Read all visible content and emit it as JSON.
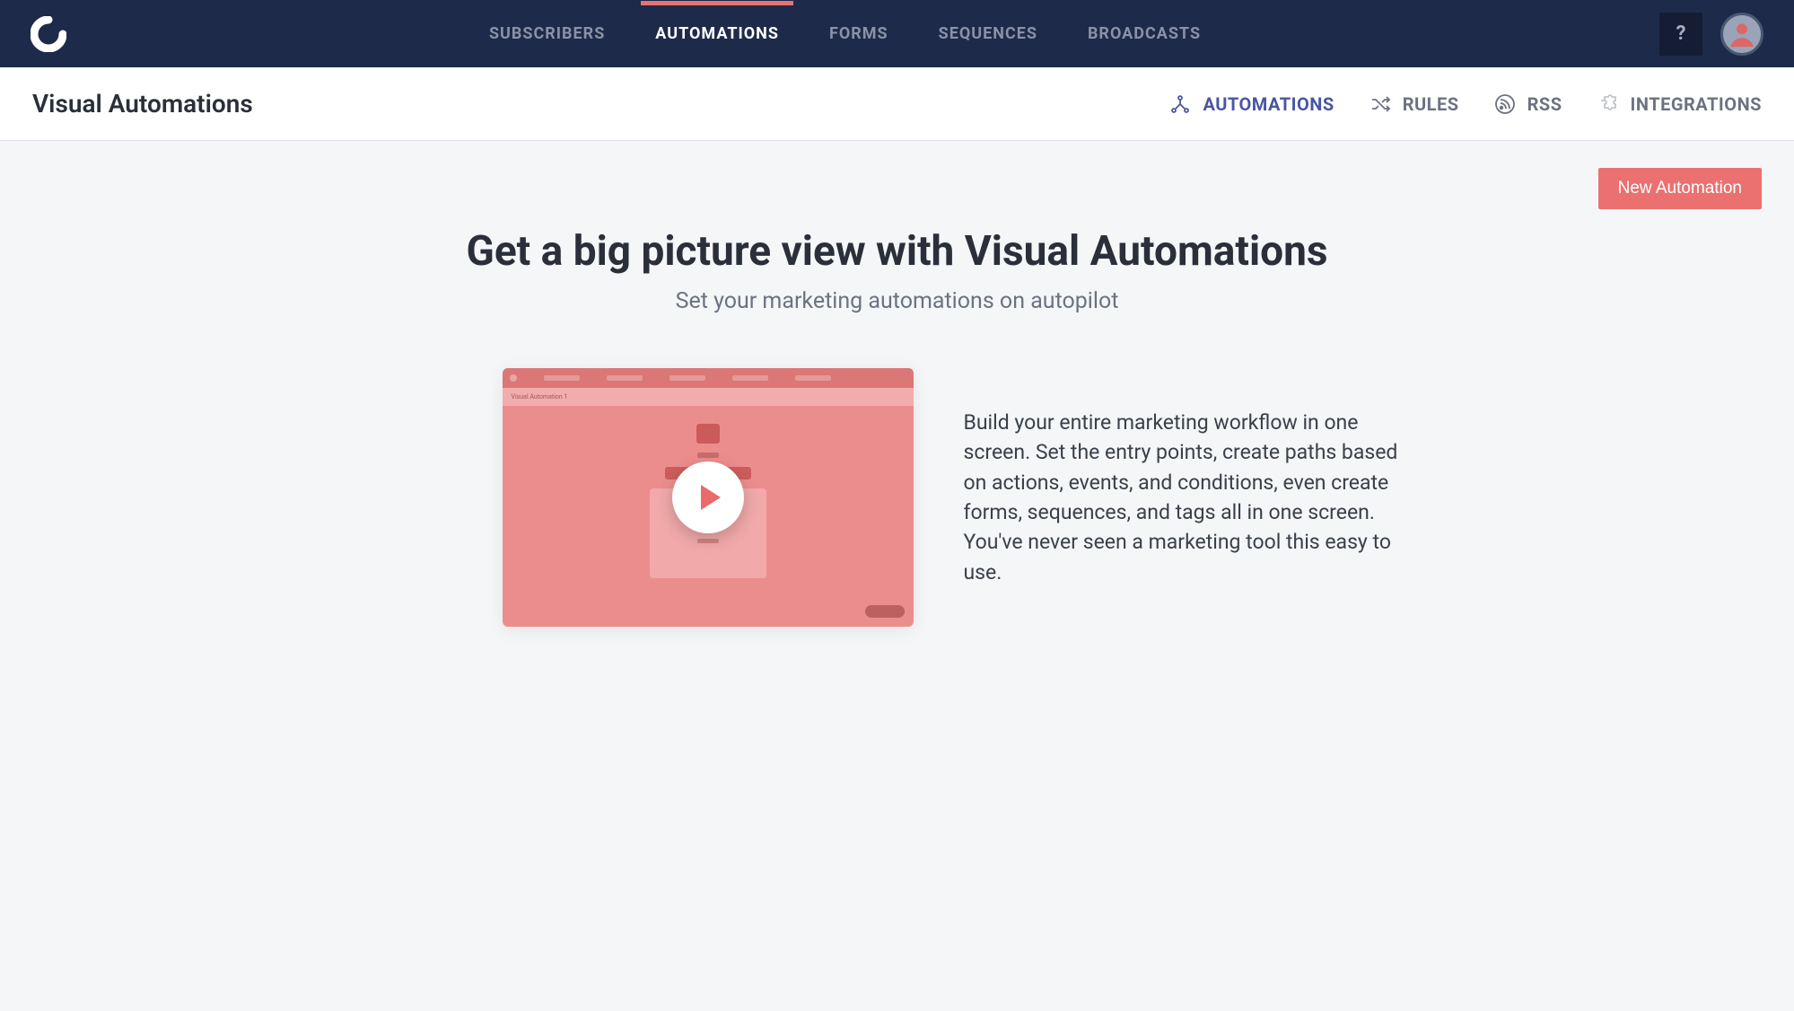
{
  "nav": {
    "items": [
      {
        "label": "SUBSCRIBERS"
      },
      {
        "label": "AUTOMATIONS"
      },
      {
        "label": "FORMS"
      },
      {
        "label": "SEQUENCES"
      },
      {
        "label": "BROADCASTS"
      }
    ],
    "help_label": "?"
  },
  "subheader": {
    "title": "Visual Automations",
    "tabs": [
      {
        "label": "AUTOMATIONS"
      },
      {
        "label": "RULES"
      },
      {
        "label": "RSS"
      },
      {
        "label": "INTEGRATIONS"
      }
    ]
  },
  "actions": {
    "new_automation": "New Automation"
  },
  "hero": {
    "title": "Get a big picture view with Visual Automations",
    "subtitle": "Set your marketing automations on autopilot"
  },
  "feature": {
    "body": "Build your entire marketing workflow in one screen. Set the entry points, create paths based on actions, events, and conditions, even create forms, sequences, and tags all in one screen. You've never seen a marketing tool this easy to use.",
    "video_mock_label": "Visual Automation 1"
  }
}
